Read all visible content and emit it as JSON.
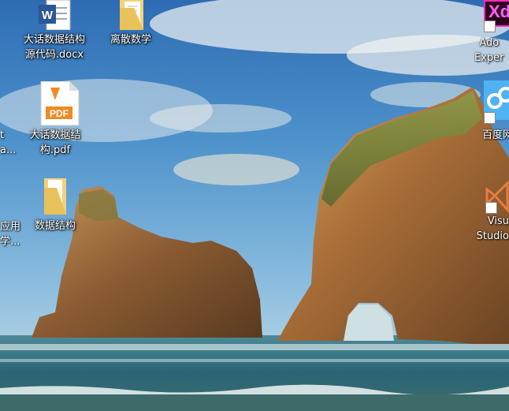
{
  "desktop": {
    "icons": {
      "docx": {
        "label": "大话数据结构\n源代码.docx",
        "type": "Word document",
        "badge": "W"
      },
      "folder_discrete": {
        "label": "离散数学",
        "type": "folder"
      },
      "pdf": {
        "label": "大话数据结\n构.pdf",
        "type": "PDF document",
        "badge": "PDF"
      },
      "folder_ds": {
        "label": "数据结构",
        "type": "folder"
      },
      "adobe_xd": {
        "label": "Ado\nExper",
        "badge": "Xd"
      },
      "baidu": {
        "label": "百度网"
      },
      "vs": {
        "label": "Visu\nStudio"
      }
    },
    "left_edge_fragments": [
      "t",
      "a...",
      "应用",
      "学..."
    ]
  },
  "colors": {
    "sky_top": "#2f72b8",
    "sky_mid": "#5a9ed2",
    "sea": "#2f6f84",
    "rock": "#9a6a3c",
    "xd_brand": "#ff2bc2"
  }
}
